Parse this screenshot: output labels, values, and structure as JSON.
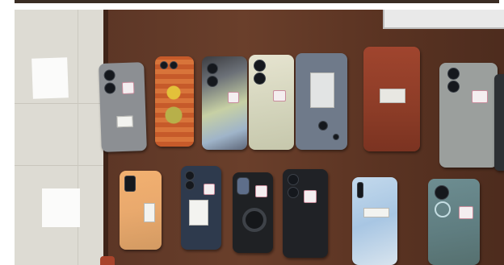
{
  "photo": {
    "scene": "phones-on-table",
    "colors": {
      "table": "#5a3524",
      "floor": "#dcdad2",
      "background": "#ffffff"
    }
  }
}
